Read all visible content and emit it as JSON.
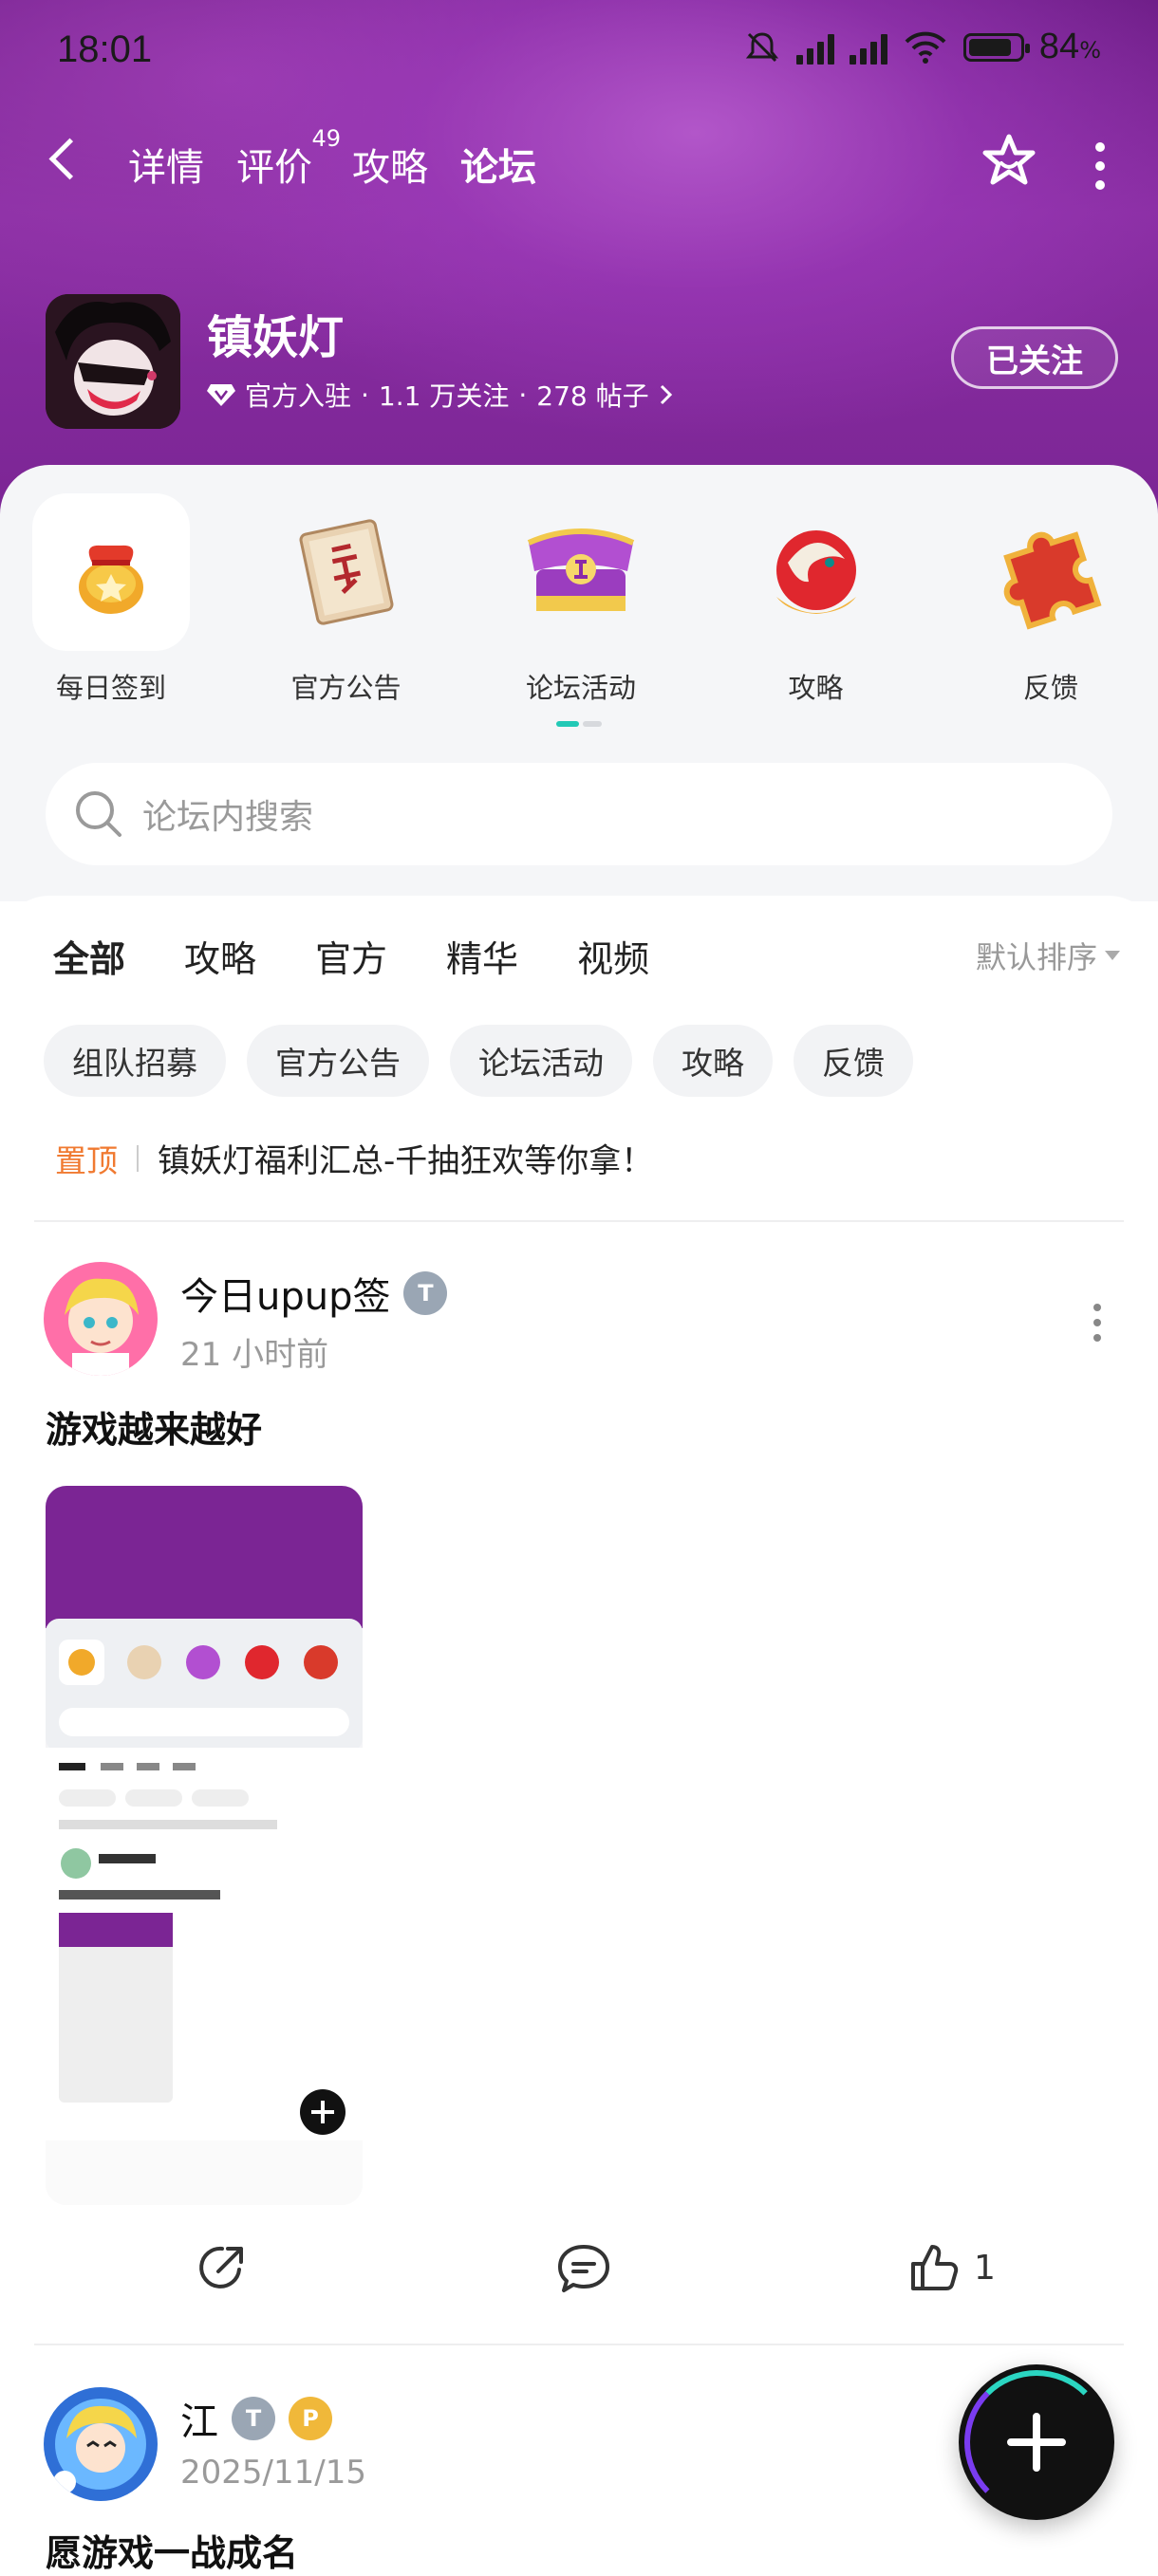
{
  "status": {
    "time": "18:01",
    "battery": "84",
    "battery_unit": "%",
    "battery_level": 0.84
  },
  "nav": {
    "tabs": [
      {
        "label": "详情",
        "active": false
      },
      {
        "label": "评价",
        "badge": "49",
        "active": false
      },
      {
        "label": "攻略",
        "active": false
      },
      {
        "label": "论坛",
        "active": true
      }
    ]
  },
  "game": {
    "name": "镇妖灯",
    "official": "官方入驻",
    "followers": "1.1 万关注",
    "posts": "278 帖子",
    "follow_label": "已关注"
  },
  "entries": [
    {
      "label": "每日签到",
      "icon": "lucky-bag-icon"
    },
    {
      "label": "官方公告",
      "icon": "scroll-icon"
    },
    {
      "label": "论坛活动",
      "icon": "chest-icon"
    },
    {
      "label": "攻略",
      "icon": "dragon-icon"
    },
    {
      "label": "反馈",
      "icon": "puzzle-icon"
    }
  ],
  "search": {
    "placeholder": "论坛内搜索"
  },
  "category_tabs": [
    "全部",
    "攻略",
    "官方",
    "精华",
    "视频"
  ],
  "sort_label": "默认排序",
  "chips": [
    "组队招募",
    "官方公告",
    "论坛活动",
    "攻略",
    "反馈"
  ],
  "pinned": {
    "tag": "置顶",
    "title": "镇妖灯福利汇总-千抽狂欢等你拿！"
  },
  "posts": [
    {
      "author": "今日upup签",
      "time": "21 小时前",
      "text": "游戏越来越好",
      "likes": "1"
    },
    {
      "author": "江",
      "time": "2025/11/15",
      "text": "愿游戏一战成名"
    }
  ],
  "colors": {
    "accent": "#2bd6c2",
    "header_purple": "#7b2594",
    "pin": "#f07a31"
  }
}
